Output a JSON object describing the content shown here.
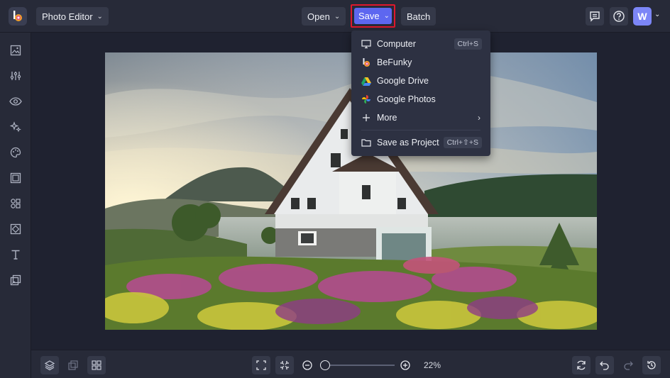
{
  "header": {
    "app_menu_label": "Photo Editor",
    "open_label": "Open",
    "save_label": "Save",
    "batch_label": "Batch",
    "avatar_initial": "W"
  },
  "save_menu": {
    "items": [
      {
        "label": "Computer",
        "shortcut": "Ctrl+S",
        "icon": "monitor-icon"
      },
      {
        "label": "BeFunky",
        "icon": "befunky-logo-icon"
      },
      {
        "label": "Google Drive",
        "icon": "google-drive-icon"
      },
      {
        "label": "Google Photos",
        "icon": "google-photos-icon"
      },
      {
        "label": "More",
        "icon": "plus-icon",
        "has_submenu": true
      },
      {
        "label": "Save as Project",
        "shortcut": "Ctrl+⇧+S",
        "icon": "folder-icon"
      }
    ]
  },
  "sidebar": {
    "icons": [
      "image-icon",
      "sliders-icon",
      "eye-icon",
      "sparkle-icon",
      "palette-icon",
      "frame-icon",
      "shapes-icon",
      "texture-icon",
      "text-icon",
      "graphics-icon"
    ]
  },
  "footer": {
    "zoom_level": "22%"
  },
  "colors": {
    "accent": "#5d67f0",
    "highlight_border": "#e0182d",
    "topbar_bg": "#272a38",
    "canvas_bg": "#1f2230"
  }
}
